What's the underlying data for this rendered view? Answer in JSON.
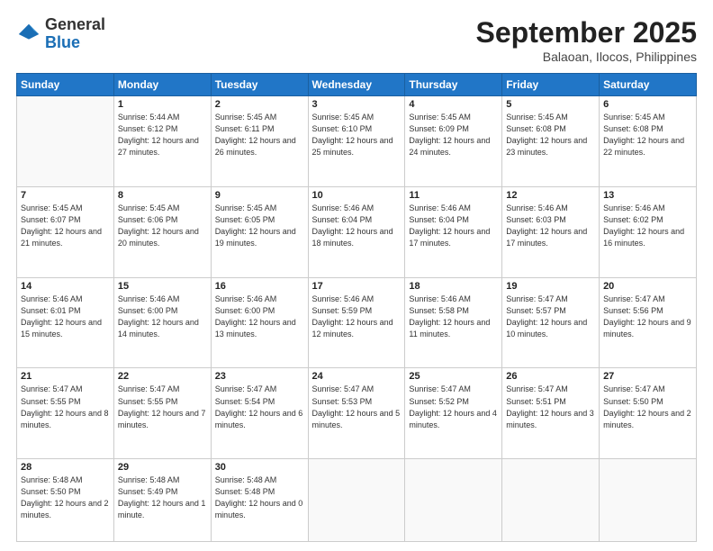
{
  "logo": {
    "general": "General",
    "blue": "Blue"
  },
  "title": {
    "month": "September 2025",
    "location": "Balaoan, Ilocos, Philippines"
  },
  "headers": [
    "Sunday",
    "Monday",
    "Tuesday",
    "Wednesday",
    "Thursday",
    "Friday",
    "Saturday"
  ],
  "weeks": [
    [
      {
        "day": "",
        "info": ""
      },
      {
        "day": "1",
        "info": "Sunrise: 5:44 AM\nSunset: 6:12 PM\nDaylight: 12 hours\nand 27 minutes."
      },
      {
        "day": "2",
        "info": "Sunrise: 5:45 AM\nSunset: 6:11 PM\nDaylight: 12 hours\nand 26 minutes."
      },
      {
        "day": "3",
        "info": "Sunrise: 5:45 AM\nSunset: 6:10 PM\nDaylight: 12 hours\nand 25 minutes."
      },
      {
        "day": "4",
        "info": "Sunrise: 5:45 AM\nSunset: 6:09 PM\nDaylight: 12 hours\nand 24 minutes."
      },
      {
        "day": "5",
        "info": "Sunrise: 5:45 AM\nSunset: 6:08 PM\nDaylight: 12 hours\nand 23 minutes."
      },
      {
        "day": "6",
        "info": "Sunrise: 5:45 AM\nSunset: 6:08 PM\nDaylight: 12 hours\nand 22 minutes."
      }
    ],
    [
      {
        "day": "7",
        "info": "Sunrise: 5:45 AM\nSunset: 6:07 PM\nDaylight: 12 hours\nand 21 minutes."
      },
      {
        "day": "8",
        "info": "Sunrise: 5:45 AM\nSunset: 6:06 PM\nDaylight: 12 hours\nand 20 minutes."
      },
      {
        "day": "9",
        "info": "Sunrise: 5:45 AM\nSunset: 6:05 PM\nDaylight: 12 hours\nand 19 minutes."
      },
      {
        "day": "10",
        "info": "Sunrise: 5:46 AM\nSunset: 6:04 PM\nDaylight: 12 hours\nand 18 minutes."
      },
      {
        "day": "11",
        "info": "Sunrise: 5:46 AM\nSunset: 6:04 PM\nDaylight: 12 hours\nand 17 minutes."
      },
      {
        "day": "12",
        "info": "Sunrise: 5:46 AM\nSunset: 6:03 PM\nDaylight: 12 hours\nand 17 minutes."
      },
      {
        "day": "13",
        "info": "Sunrise: 5:46 AM\nSunset: 6:02 PM\nDaylight: 12 hours\nand 16 minutes."
      }
    ],
    [
      {
        "day": "14",
        "info": "Sunrise: 5:46 AM\nSunset: 6:01 PM\nDaylight: 12 hours\nand 15 minutes."
      },
      {
        "day": "15",
        "info": "Sunrise: 5:46 AM\nSunset: 6:00 PM\nDaylight: 12 hours\nand 14 minutes."
      },
      {
        "day": "16",
        "info": "Sunrise: 5:46 AM\nSunset: 6:00 PM\nDaylight: 12 hours\nand 13 minutes."
      },
      {
        "day": "17",
        "info": "Sunrise: 5:46 AM\nSunset: 5:59 PM\nDaylight: 12 hours\nand 12 minutes."
      },
      {
        "day": "18",
        "info": "Sunrise: 5:46 AM\nSunset: 5:58 PM\nDaylight: 12 hours\nand 11 minutes."
      },
      {
        "day": "19",
        "info": "Sunrise: 5:47 AM\nSunset: 5:57 PM\nDaylight: 12 hours\nand 10 minutes."
      },
      {
        "day": "20",
        "info": "Sunrise: 5:47 AM\nSunset: 5:56 PM\nDaylight: 12 hours\nand 9 minutes."
      }
    ],
    [
      {
        "day": "21",
        "info": "Sunrise: 5:47 AM\nSunset: 5:55 PM\nDaylight: 12 hours\nand 8 minutes."
      },
      {
        "day": "22",
        "info": "Sunrise: 5:47 AM\nSunset: 5:55 PM\nDaylight: 12 hours\nand 7 minutes."
      },
      {
        "day": "23",
        "info": "Sunrise: 5:47 AM\nSunset: 5:54 PM\nDaylight: 12 hours\nand 6 minutes."
      },
      {
        "day": "24",
        "info": "Sunrise: 5:47 AM\nSunset: 5:53 PM\nDaylight: 12 hours\nand 5 minutes."
      },
      {
        "day": "25",
        "info": "Sunrise: 5:47 AM\nSunset: 5:52 PM\nDaylight: 12 hours\nand 4 minutes."
      },
      {
        "day": "26",
        "info": "Sunrise: 5:47 AM\nSunset: 5:51 PM\nDaylight: 12 hours\nand 3 minutes."
      },
      {
        "day": "27",
        "info": "Sunrise: 5:47 AM\nSunset: 5:50 PM\nDaylight: 12 hours\nand 2 minutes."
      }
    ],
    [
      {
        "day": "28",
        "info": "Sunrise: 5:48 AM\nSunset: 5:50 PM\nDaylight: 12 hours\nand 2 minutes."
      },
      {
        "day": "29",
        "info": "Sunrise: 5:48 AM\nSunset: 5:49 PM\nDaylight: 12 hours\nand 1 minute."
      },
      {
        "day": "30",
        "info": "Sunrise: 5:48 AM\nSunset: 5:48 PM\nDaylight: 12 hours\nand 0 minutes."
      },
      {
        "day": "",
        "info": ""
      },
      {
        "day": "",
        "info": ""
      },
      {
        "day": "",
        "info": ""
      },
      {
        "day": "",
        "info": ""
      }
    ]
  ]
}
